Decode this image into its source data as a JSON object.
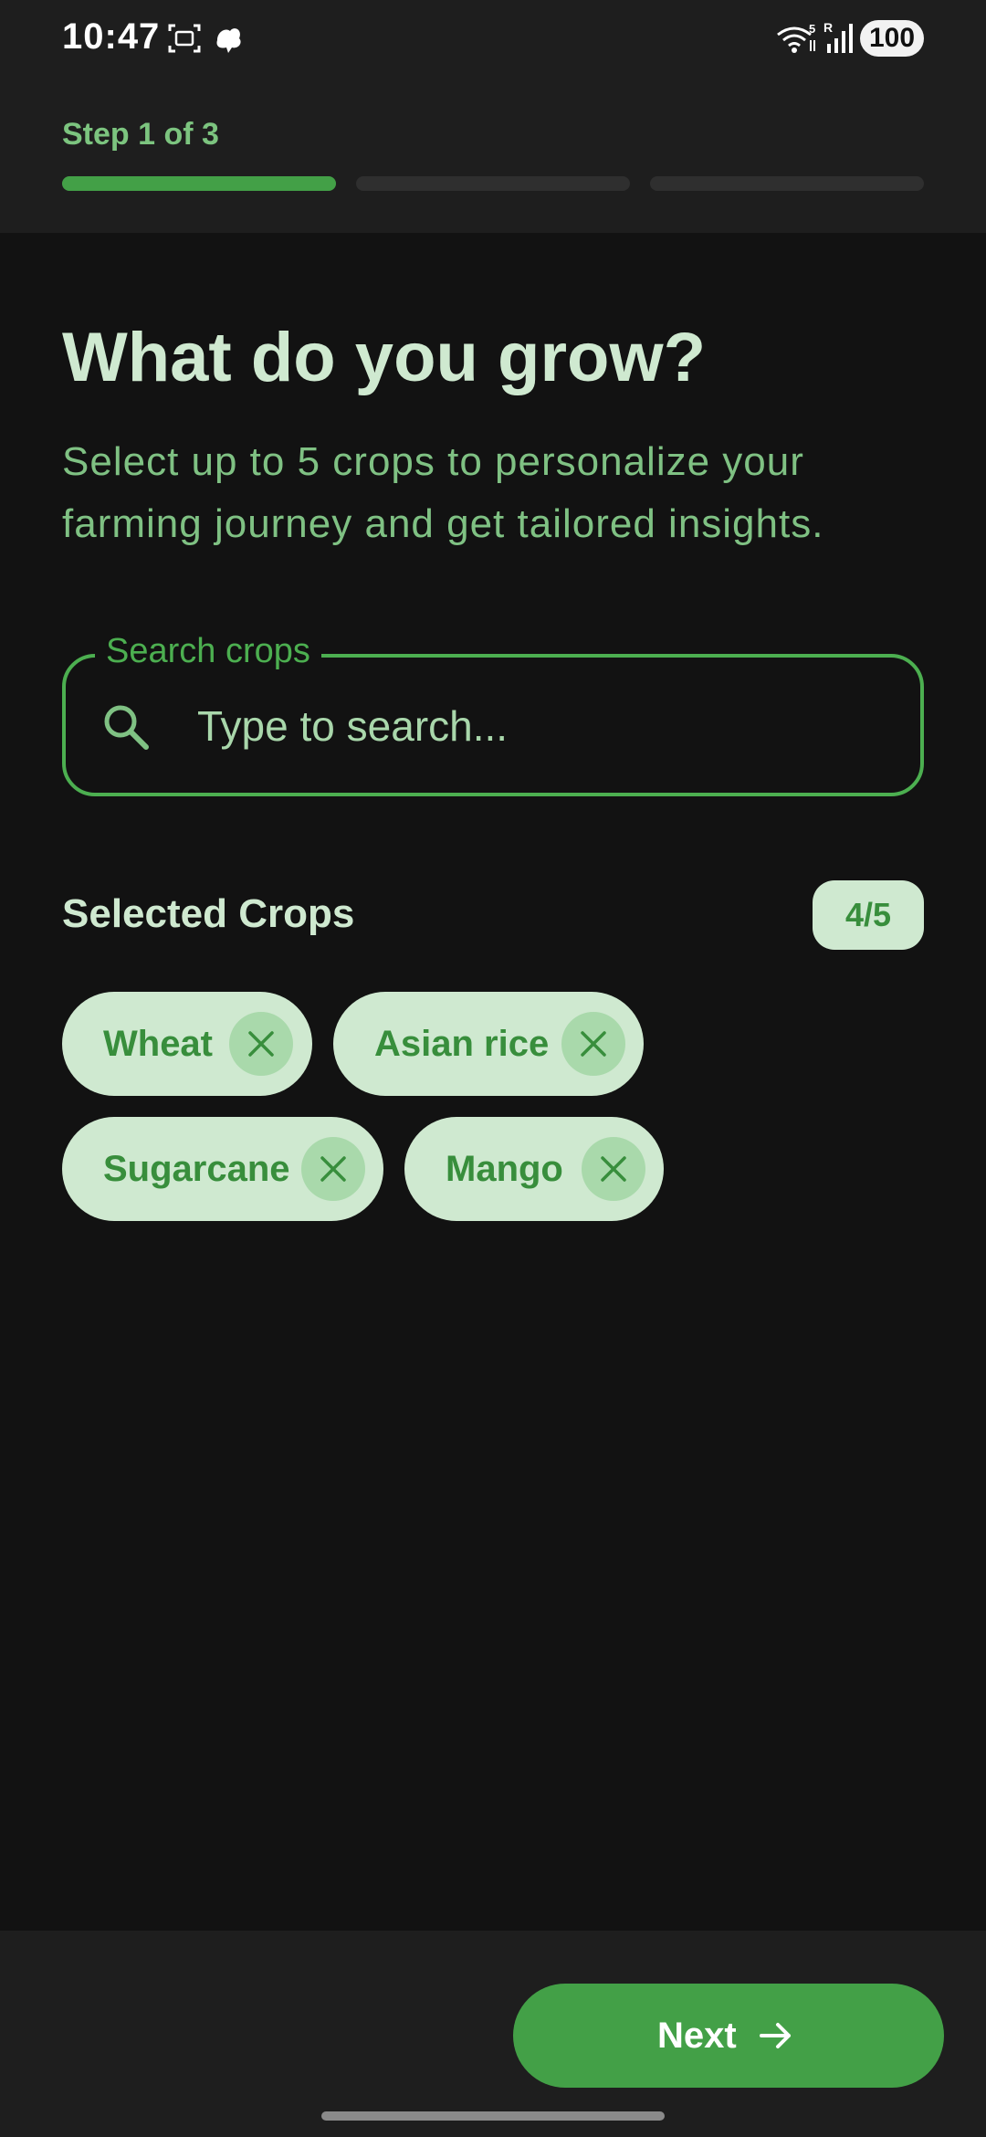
{
  "status_bar": {
    "time": "10:47",
    "battery": "100",
    "icons": [
      "screenshot-icon",
      "notification-icon",
      "wifi-icon",
      "signal-icon"
    ]
  },
  "header": {
    "step_label": "Step 1 of 3",
    "progress": {
      "current_step": 1,
      "total_steps": 3
    }
  },
  "main": {
    "title": "What do you grow?",
    "subtitle": "Select up to 5 crops to personalize your farming journey and get tailored insights.",
    "search": {
      "label": "Search crops",
      "placeholder": "Type to search...",
      "value": ""
    },
    "selected": {
      "title": "Selected Crops",
      "count": "4/5",
      "chips": [
        {
          "label": "Wheat"
        },
        {
          "label": "Asian rice"
        },
        {
          "label": "Sugarcane"
        },
        {
          "label": "Mango"
        }
      ]
    }
  },
  "footer": {
    "next_label": "Next"
  },
  "colors": {
    "accent": "#43a047",
    "chip_bg": "#cfe9d0",
    "background": "#121212"
  }
}
